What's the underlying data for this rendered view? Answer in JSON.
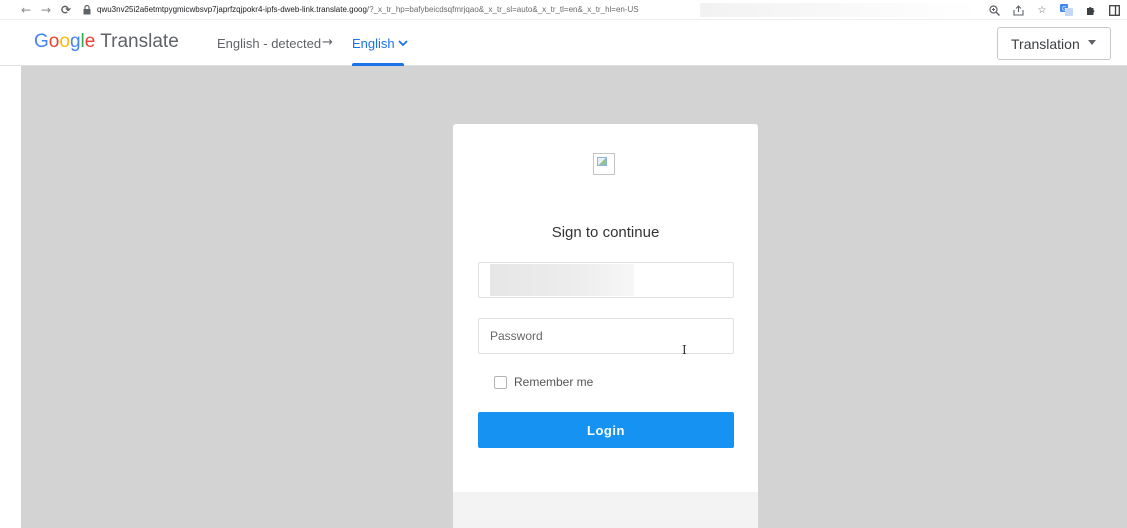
{
  "browser": {
    "url_main": "qwu3nv25i2a6etmtpygmicwbsvp7japrfzqjpokr4-ipfs-dweb-link.translate.goog",
    "url_rest": "/?_x_tr_hp=bafybeicdsqfmrjqao&_x_tr_sl=auto&_x_tr_tl=en&_x_tr_hl=en-US",
    "icons": [
      "back-arrow-icon",
      "forward-arrow-icon",
      "reload-icon",
      "lock-icon",
      "zoom-icon",
      "share-icon",
      "star-icon",
      "translate-icon",
      "extensions-icon",
      "sidepanel-icon"
    ]
  },
  "translate_bar": {
    "logo_letters": [
      "G",
      "o",
      "o",
      "g",
      "l",
      "e"
    ],
    "logo_word": "Translate",
    "source_lang": "English - detected",
    "arrow": "→",
    "target_lang": "English",
    "view_select": "Translation",
    "accent_color": "#1a73e8"
  },
  "login": {
    "title": "Sign to continue",
    "password_placeholder": "Password",
    "remember_label": "Remember me",
    "login_label": "Login",
    "button_color": "#1592f2"
  }
}
